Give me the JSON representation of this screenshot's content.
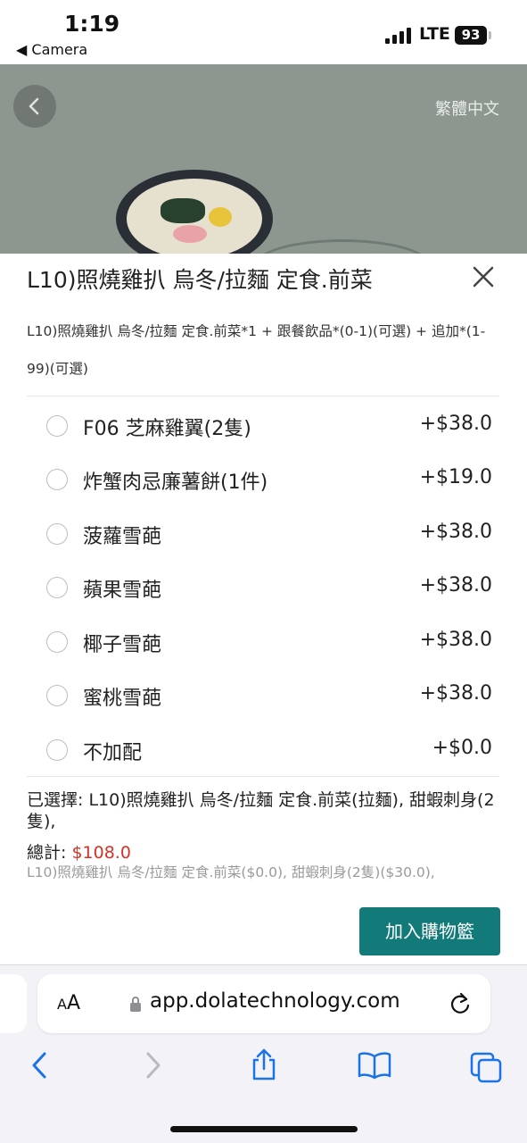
{
  "status_bar": {
    "time": "1:19",
    "back_app": "◀ Camera",
    "network": "LTE",
    "battery": "93"
  },
  "hero": {
    "language": "繁體中文"
  },
  "sheet": {
    "title": "L10)照燒雞扒 烏冬/拉麵 定食.前菜",
    "description": "L10)照燒雞扒 烏冬/拉麵 定食.前菜*1 + 跟餐飲品*(0-1)(可選) + 追加*(1-99)(可選)",
    "options": [
      {
        "name": "F06 芝麻雞翼(2隻)",
        "price": "+$38.0"
      },
      {
        "name": "炸蟹肉忌廉薯餅(1件)",
        "price": "+$19.0"
      },
      {
        "name": "菠蘿雪葩",
        "price": "+$38.0"
      },
      {
        "name": "蘋果雪葩",
        "price": "+$38.0"
      },
      {
        "name": "椰子雪葩",
        "price": "+$38.0"
      },
      {
        "name": "蜜桃雪葩",
        "price": "+$38.0"
      },
      {
        "name": "不加配",
        "price": "+$0.0"
      }
    ],
    "selected_label": "已選擇:",
    "selected_value": "L10)照燒雞扒 烏冬/拉麵 定食.前菜(拉麵), 甜蝦刺身(2隻),",
    "total_label": "總計:",
    "total_value": "$108.0",
    "breakdown": "L10)照燒雞扒 烏冬/拉麵 定食.前菜($0.0), 甜蝦刺身(2隻)($30.0),",
    "add_to_cart": "加入購物籃"
  },
  "browser": {
    "aa_small": "A",
    "aa_large": "A",
    "url": "app.dolatechnology.com"
  },
  "colors": {
    "accent": "#137a7a",
    "price_red": "#d93025"
  }
}
